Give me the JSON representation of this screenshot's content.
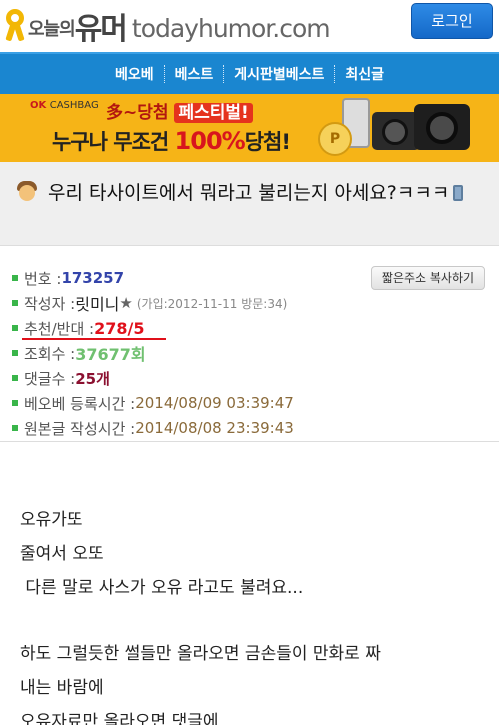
{
  "header": {
    "logo_kr_small": "오늘의",
    "logo_kr_big": "유머",
    "logo_en": "todayhumor.com",
    "login_label": "로그인"
  },
  "nav": {
    "items": [
      "베오베",
      "베스트",
      "게시판별베스트",
      "최신글"
    ]
  },
  "banner": {
    "brand": "OK",
    "brand_sub": "CASHBAG",
    "line1_prefix": "多~당첨",
    "line1_fest": "페스티벌!",
    "line2_prefix": "누구나 무조건 ",
    "line2_pct": "100%",
    "line2_suffix": "당첨!",
    "coin_label": "P"
  },
  "post": {
    "title": "우리 타사이트에서 뭐라고 불리는지 아세요?ㅋㅋㅋ",
    "copy_button": "짧은주소 복사하기",
    "number_label": "번호 : ",
    "number": "173257",
    "author_label": "작성자 : ",
    "author": "릿미니",
    "author_star": "★",
    "author_meta": "(가입:2012-11-11 방문:34)",
    "recommend_label": "추천/반대 : ",
    "recommend": "278/5",
    "views_label": "조회수 : ",
    "views": "37677회",
    "comments_label": "댓글수 : ",
    "comments": "25개",
    "bob_time_label": "베오베 등록시간 : ",
    "bob_time": "2014/08/09 03:39:47",
    "orig_time_label": "원본글 작성시간 : ",
    "orig_time": "2014/08/08 23:39:43"
  },
  "body": {
    "lines": [
      "오유가또",
      "줄여서 오또",
      " 다른 말로 사스가 오유 라고도 불려요...",
      "하도 그럴듯한 썰들만 올라오면 금손들이 만화로 짜",
      "내는 바람에",
      "오유자료만 올라오면 댓글에"
    ]
  },
  "colors": {
    "nav_bg": "#1a86d0",
    "login_bg": "#1a75d8",
    "banner_bg": "#f6b417",
    "recommend": "#e0101a",
    "number": "#3344aa",
    "views": "#70c070",
    "comments": "#8b1030",
    "bullet": "#39b54a"
  }
}
